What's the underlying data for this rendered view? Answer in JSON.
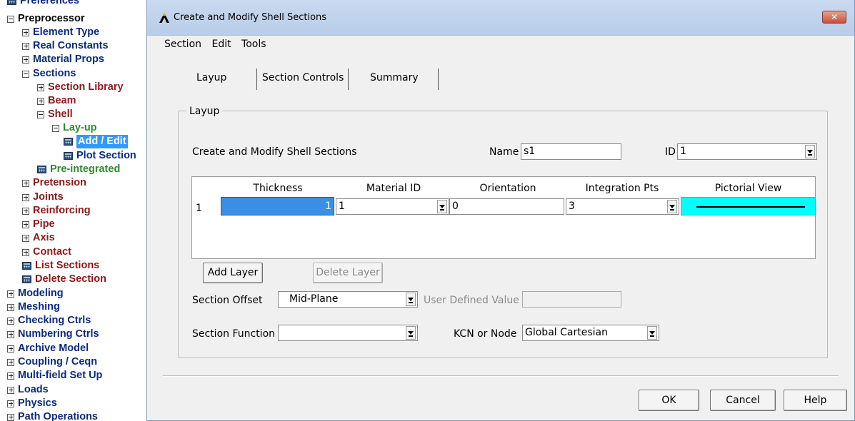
{
  "tree": {
    "items": [
      {
        "label": "Preferences",
        "icon": "calc",
        "color": "navy"
      },
      {
        "label": "Preprocessor",
        "icon": "minus",
        "color": "black"
      },
      {
        "label": "Element Type",
        "icon": "plus",
        "color": "navy"
      },
      {
        "label": "Real Constants",
        "icon": "plus",
        "color": "navy"
      },
      {
        "label": "Material Props",
        "icon": "plus",
        "color": "navy"
      },
      {
        "label": "Sections",
        "icon": "minus",
        "color": "navy"
      },
      {
        "label": "Section Library",
        "icon": "plus",
        "color": "red"
      },
      {
        "label": "Beam",
        "icon": "plus",
        "color": "red"
      },
      {
        "label": "Shell",
        "icon": "minus",
        "color": "red"
      },
      {
        "label": "Lay-up",
        "icon": "minus",
        "color": "green"
      },
      {
        "label": "Add / Edit",
        "icon": "calc",
        "color": "navy",
        "selected": true
      },
      {
        "label": "Plot Section",
        "icon": "calc",
        "color": "navy"
      },
      {
        "label": "Pre-integrated",
        "icon": "calc",
        "color": "green"
      },
      {
        "label": "Pretension",
        "icon": "plus",
        "color": "red"
      },
      {
        "label": "Joints",
        "icon": "plus",
        "color": "red"
      },
      {
        "label": "Reinforcing",
        "icon": "plus",
        "color": "red"
      },
      {
        "label": "Pipe",
        "icon": "plus",
        "color": "red"
      },
      {
        "label": "Axis",
        "icon": "plus",
        "color": "red"
      },
      {
        "label": "Contact",
        "icon": "plus",
        "color": "red"
      },
      {
        "label": "List Sections",
        "icon": "calc",
        "color": "red"
      },
      {
        "label": "Delete Section",
        "icon": "calc",
        "color": "red"
      },
      {
        "label": "Modeling",
        "icon": "plus",
        "color": "navy"
      },
      {
        "label": "Meshing",
        "icon": "plus",
        "color": "navy"
      },
      {
        "label": "Checking Ctrls",
        "icon": "plus",
        "color": "navy"
      },
      {
        "label": "Numbering Ctrls",
        "icon": "plus",
        "color": "navy"
      },
      {
        "label": "Archive Model",
        "icon": "plus",
        "color": "navy"
      },
      {
        "label": "Coupling / Ceqn",
        "icon": "plus",
        "color": "navy"
      },
      {
        "label": "Multi-field Set Up",
        "icon": "plus",
        "color": "navy"
      },
      {
        "label": "Loads",
        "icon": "plus",
        "color": "navy"
      },
      {
        "label": "Physics",
        "icon": "plus",
        "color": "navy"
      },
      {
        "label": "Path Operations",
        "icon": "plus",
        "color": "navy"
      }
    ]
  },
  "dialog": {
    "title": "Create and Modify Shell Sections",
    "close_label": "✕",
    "menu": [
      "Section",
      "Edit",
      "Tools"
    ],
    "tabs": [
      "Layup",
      "Section Controls",
      "Summary"
    ],
    "group_label": "Layup",
    "heading": "Create and Modify Shell Sections",
    "name_label": "Name",
    "name_value": "s1",
    "id_label": "ID",
    "id_value": "1",
    "columns": [
      "Thickness",
      "Material ID",
      "Orientation",
      "Integration Pts",
      "Pictorial View"
    ],
    "row": {
      "index": "1",
      "thickness": "1",
      "material_id": "1",
      "orientation": "0",
      "integration_pts": "3"
    },
    "add_layer": "Add Layer",
    "delete_layer": "Delete Layer",
    "offset_label": "Section Offset",
    "offset_value": "Mid-Plane",
    "user_value_label": "User Defined Value",
    "user_value": "",
    "function_label": "Section Function",
    "function_value": "",
    "kcn_label": "KCN or Node",
    "kcn_value": "Global Cartesian",
    "ok": "OK",
    "cancel": "Cancel",
    "help": "Help"
  },
  "colors": {
    "selection": "#3399ff",
    "pictorial_bg": "#00ffff",
    "tree_navy": "#0b2a7e",
    "tree_red": "#8b1a1a",
    "tree_green": "#2e8b2e"
  }
}
